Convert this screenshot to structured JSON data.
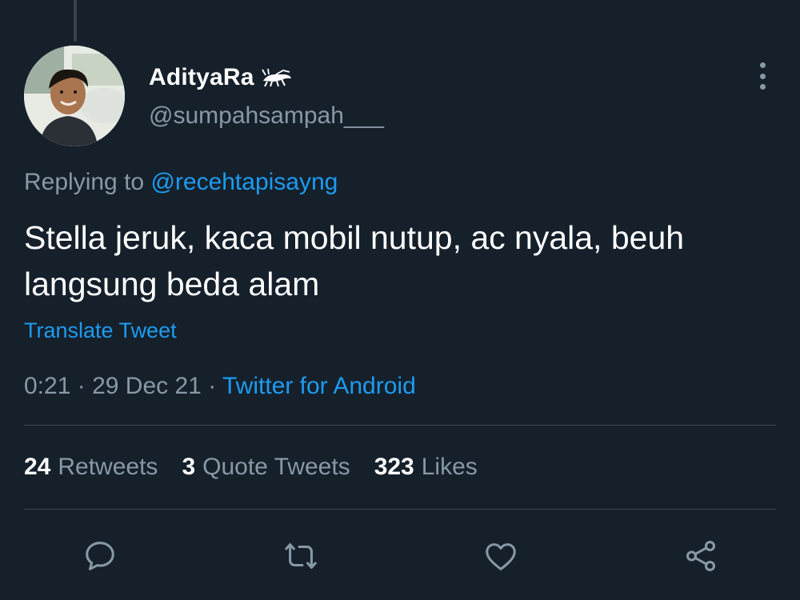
{
  "tweet": {
    "author": {
      "display_name": "AdityaRa",
      "name_emoji_icon": "cricket-icon",
      "handle": "@sumpahsampah___"
    },
    "replying_prefix": "Replying to",
    "replying_to": "@recehtapisayng",
    "text": "Stella jeruk, kaca mobil nutup, ac nyala, beuh langsung beda alam",
    "translate_label": "Translate Tweet",
    "time": "0:21",
    "date": "29 Dec 21",
    "separator": "·",
    "source": "Twitter for Android"
  },
  "stats": {
    "retweets_count": "24",
    "retweets_label": "Retweets",
    "quotes_count": "3",
    "quotes_label": "Quote Tweets",
    "likes_count": "323",
    "likes_label": "Likes"
  },
  "actions": [
    "reply-icon",
    "retweet-icon",
    "like-icon",
    "share-icon"
  ],
  "colors": {
    "background": "#15202b",
    "accent": "#1d9bf0",
    "secondary_text": "#8899a6",
    "divider": "#38444d"
  }
}
